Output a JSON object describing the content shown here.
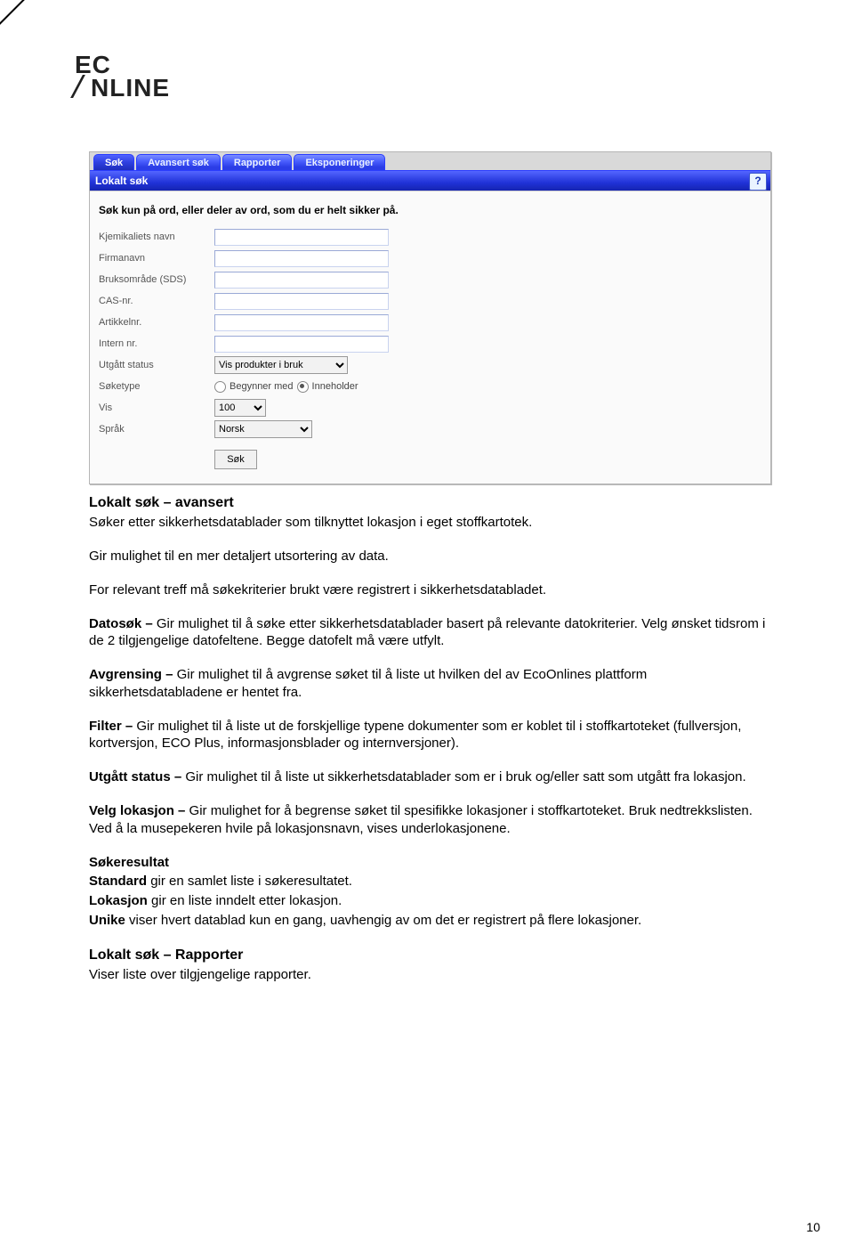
{
  "logo": {
    "line1": "EC",
    "line2": "NLINE"
  },
  "ui": {
    "tabs": [
      "Søk",
      "Avansert søk",
      "Rapporter",
      "Eksponeringer"
    ],
    "subbar_title": "Lokalt søk",
    "help_label": "?",
    "hint": "Søk kun på ord, eller deler av ord, som du er helt sikker på.",
    "fields": {
      "chem_label": "Kjemikaliets navn",
      "firm_label": "Firmanavn",
      "use_label": "Bruksområde (SDS)",
      "cas_label": "CAS-nr.",
      "art_label": "Artikkelnr.",
      "int_label": "Intern nr.",
      "status_label": "Utgått status",
      "status_value": "Vis produkter i bruk",
      "searchtype_label": "Søketype",
      "searchtype_opt1": "Begynner med",
      "searchtype_opt2": "Inneholder",
      "vis_label": "Vis",
      "vis_value": "100",
      "lang_label": "Språk",
      "lang_value": "Norsk"
    },
    "search_button": "Søk"
  },
  "doc": {
    "h1": "Lokalt søk – avansert",
    "p1": "Søker etter sikkerhetsdatablader som tilknyttet lokasjon i eget stoffkartotek.",
    "p2": "Gir mulighet til en mer detaljert utsortering av data.",
    "p3": "For relevant treff må søkekriterier brukt være registrert i sikkerhetsdatabladet.",
    "datosok_b": "Datosøk – ",
    "datosok_t": "Gir mulighet til å søke etter sikkerhetsdatablader basert på relevante datokriterier. Velg ønsket tidsrom i de 2 tilgjengelige datofeltene. Begge datofelt må være utfylt.",
    "avgrens_b": "Avgrensing – ",
    "avgrens_t": "Gir mulighet til å avgrense søket til å liste ut hvilken del av EcoOnlines plattform sikkerhetsdatabladene er hentet fra.",
    "filter_b": "Filter – ",
    "filter_t": "Gir mulighet til å liste ut de forskjellige typene dokumenter som er koblet til i stoffkartoteket (fullversjon, kortversjon, ECO Plus, informasjonsblader og internversjoner).",
    "utgatt_b": "Utgått status – ",
    "utgatt_t": "Gir mulighet til å liste ut sikkerhetsdatablader som er i bruk og/eller satt som utgått fra lokasjon.",
    "velg_b": "Velg lokasjon – ",
    "velg_t": "Gir mulighet for å begrense søket til spesifikke lokasjoner i stoffkartoteket. Bruk nedtrekkslisten. Ved å la musepekeren hvile på lokasjonsnavn, vises underlokasjonene.",
    "sokres_b": "Søkeresultat",
    "standard_b": "Standard ",
    "standard_t": "gir en samlet liste i søkeresultatet.",
    "lokasjon_b": "Lokasjon ",
    "lokasjon_t": "gir en liste inndelt etter lokasjon.",
    "unike_b": "Unike ",
    "unike_t": "viser hvert datablad kun en gang, uavhengig av om det er registrert på flere lokasjoner.",
    "h2": "Lokalt søk – Rapporter",
    "p_rap": "Viser liste over tilgjengelige rapporter."
  },
  "page_number": "10"
}
